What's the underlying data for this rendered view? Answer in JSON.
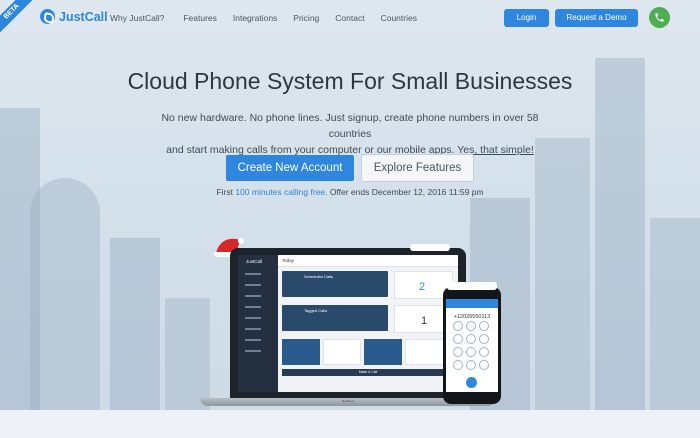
{
  "nav": {
    "badge": "BETA",
    "logo_text": "JustCall",
    "items": [
      "Why JustCall?",
      "Features",
      "Integrations",
      "Pricing",
      "Contact",
      "Countries"
    ],
    "login_label": "Login",
    "demo_label": "Request a Demo"
  },
  "hero": {
    "title": "Cloud Phone System For Small Businesses",
    "subtitle_line1": "No new hardware. No phone lines. Just signup, create phone numbers in over 58 countries",
    "subtitle_line2_prefix": "and start making calls from your computer or our mobile apps. ",
    "subtitle_line2_link": "Yes, that simple!",
    "cta_primary": "Create New Account",
    "cta_secondary": "Explore Features",
    "offer_prefix": "First ",
    "offer_highlight": "100 minutes calling free.",
    "offer_suffix": " Offer ends December 12, 2016 11:59 pm"
  },
  "mockup": {
    "app_name": "JustCall",
    "screen_header": "Today",
    "card1_title": "Scheduled Calls",
    "card2_title": "Tagged Calls",
    "count1": "2",
    "count2": "1",
    "bottom_bar": "Make A Call",
    "laptop_brand": "MacBook",
    "phone_number": "+12026550113"
  },
  "colors": {
    "accent": "#2e86de",
    "call_button": "#4caf50"
  },
  "icons": [
    "phone-icon",
    "santa-hat-icon"
  ]
}
